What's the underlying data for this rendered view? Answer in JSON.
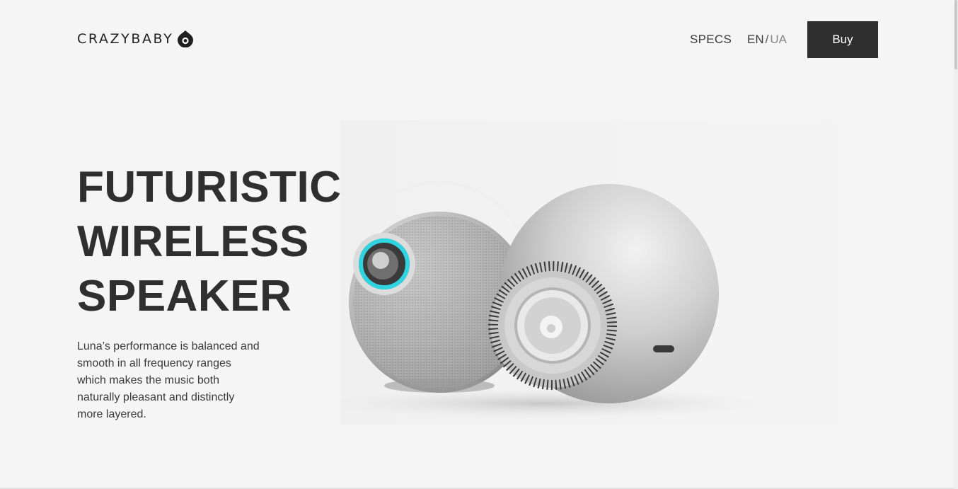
{
  "header": {
    "logo_text": "CRAZYBABY",
    "logo_icon": "crazybaby-drop-icon",
    "nav": {
      "specs_label": "SPECS",
      "lang_active": "EN",
      "lang_separator": "/",
      "lang_inactive": "UA"
    },
    "buy_label": "Buy"
  },
  "hero": {
    "title_lines": [
      "FUTURISTIC",
      "WIRELESS",
      "SPEAKER"
    ],
    "description": "Luna’s performance is balanced and smooth in all frequency ranges which makes the music both naturally pleasant and distinctly more layered.",
    "product_image": "two-spherical-silver-speakers"
  },
  "colors": {
    "background": "#f5f5f5",
    "text": "#2f2f2f",
    "button": "#2f2f2f",
    "accent_glow": "#2fd4e0"
  }
}
